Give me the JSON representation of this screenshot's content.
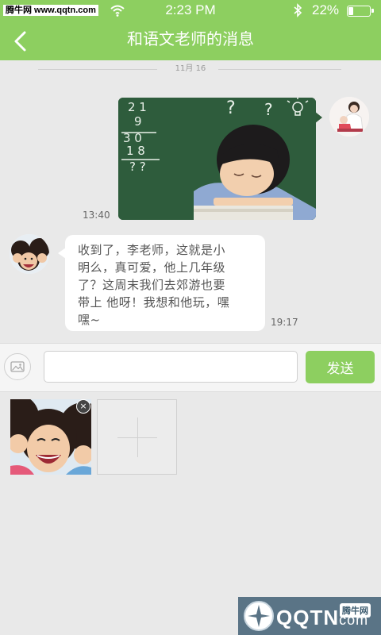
{
  "status_bar": {
    "watermark": "腾牛网 www.qqtn.com",
    "time": "2:23 PM",
    "battery_percent": "22%",
    "battery_level": 0.22,
    "icons": [
      "wifi-icon",
      "bluetooth-icon",
      "battery-icon"
    ]
  },
  "header": {
    "back_icon": "chevron-left-icon",
    "title": "和语文老师的消息"
  },
  "chat": {
    "date_separator": "11月 16",
    "messages": [
      {
        "direction": "outgoing",
        "type": "image",
        "image_desc": "child-sleeping-at-chalkboard",
        "chalk_text": [
          "2 1",
          "9",
          "3 0",
          "1 8",
          "? ?",
          "?",
          "?"
        ],
        "time": "13:40"
      },
      {
        "direction": "incoming",
        "type": "text",
        "lines": [
          "收到了，李老师，这就是小",
          "明么，真可爱，他上几年级",
          "了？这周末我们去郊游也要",
          "带上 他呀！我想和他玩，嘿",
          "嘿~"
        ],
        "time": "19:17"
      }
    ]
  },
  "input_bar": {
    "image_icon": "image-icon",
    "placeholder": "",
    "value": "",
    "send_label": "发送"
  },
  "attachments": {
    "remove_symbol": "×",
    "add_icon": "plus-icon"
  },
  "brand_logo": {
    "text": "QQTN",
    "suffix": "com",
    "site": "腾牛网"
  },
  "colors": {
    "accent": "#8dcf60",
    "background": "#e9e9e9",
    "bubble_incoming": "#ffffff"
  }
}
